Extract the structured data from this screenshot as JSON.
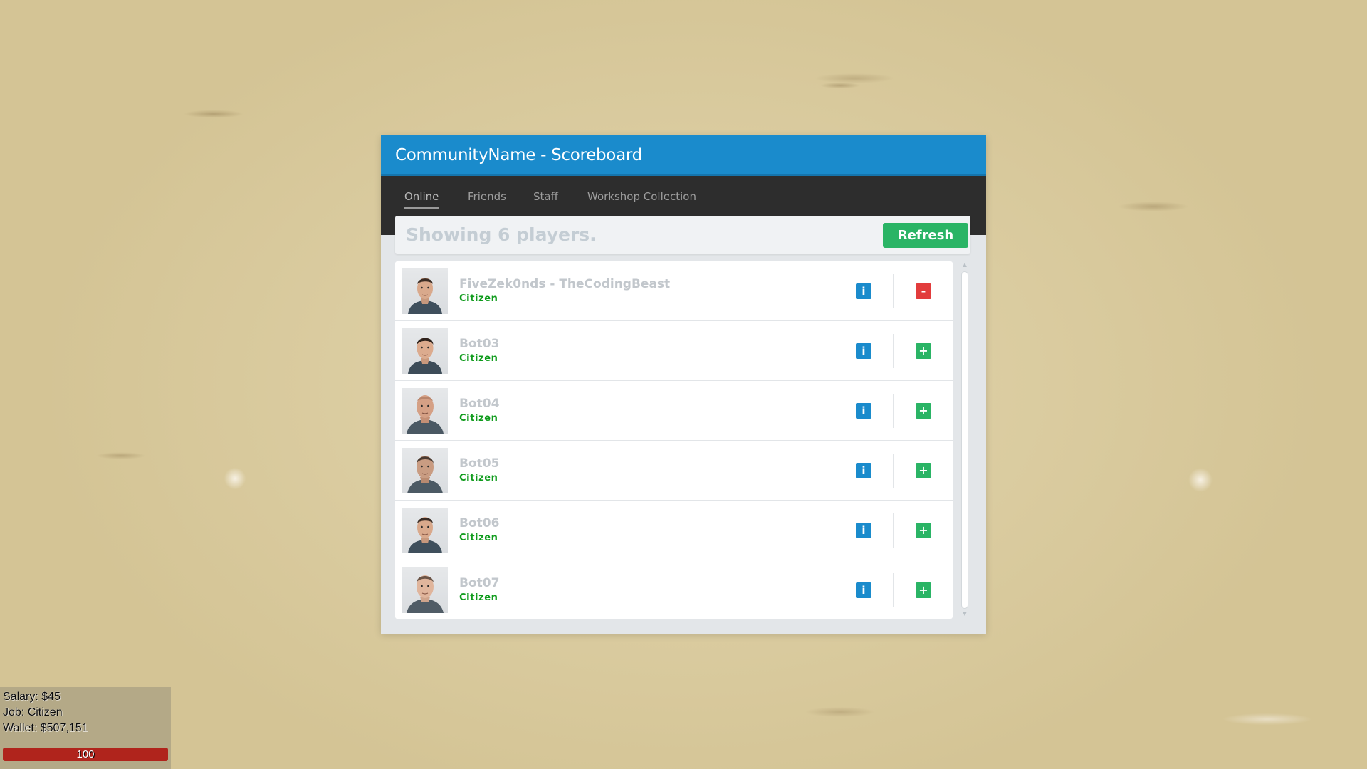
{
  "scoreboard": {
    "title": "CommunityName - Scoreboard",
    "tabs": [
      {
        "label": "Online",
        "active": true
      },
      {
        "label": "Friends",
        "active": false
      },
      {
        "label": "Staff",
        "active": false
      },
      {
        "label": "Workshop Collection",
        "active": false
      }
    ],
    "status_text": "Showing 6 players.",
    "refresh_label": "Refresh",
    "players": [
      {
        "name": "FiveZek0nds - TheCodingBeast",
        "job": "Citizen",
        "info_label": "i",
        "action_label": "-",
        "action": "remove"
      },
      {
        "name": "Bot03",
        "job": "Citizen",
        "info_label": "i",
        "action_label": "+",
        "action": "add"
      },
      {
        "name": "Bot04",
        "job": "Citizen",
        "info_label": "i",
        "action_label": "+",
        "action": "add"
      },
      {
        "name": "Bot05",
        "job": "Citizen",
        "info_label": "i",
        "action_label": "+",
        "action": "add"
      },
      {
        "name": "Bot06",
        "job": "Citizen",
        "info_label": "i",
        "action_label": "+",
        "action": "add"
      },
      {
        "name": "Bot07",
        "job": "Citizen",
        "info_label": "i",
        "action_label": "+",
        "action": "add"
      }
    ],
    "colors": {
      "header": "#1a8bcc",
      "nav": "#2d2d2d",
      "refresh": "#2ab465",
      "job": "#0f9b1c",
      "info_button": "#1a8bcc",
      "add_button": "#2ab465",
      "remove_button": "#e23c3c"
    }
  },
  "hud": {
    "salary": "Salary: $45",
    "job": "Job: Citizen",
    "wallet": "Wallet: $507,151",
    "health_text": "100",
    "health_fraction": 1.0,
    "health_color": "#b0241c"
  }
}
